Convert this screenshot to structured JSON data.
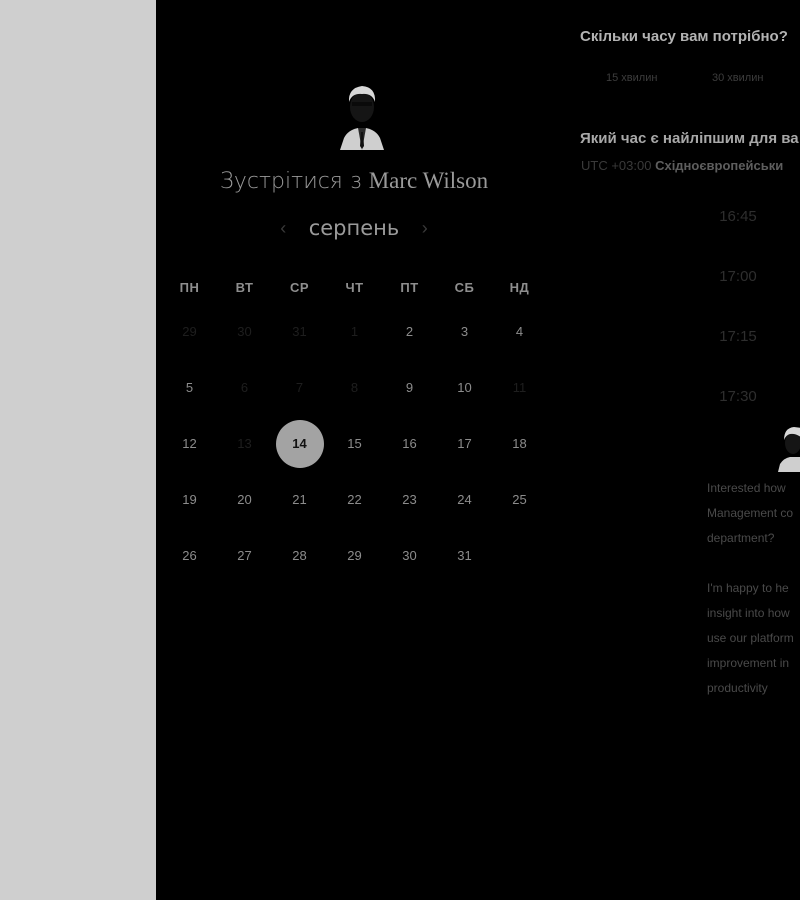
{
  "host": {
    "title_prefix": "Зустрітися з",
    "name": "Marc Wilson"
  },
  "calendar": {
    "month": "серпень",
    "prev_icon": "chevron-left-icon",
    "next_icon": "chevron-right-icon",
    "weekdays": [
      "ПН",
      "ВТ",
      "СР",
      "ЧТ",
      "ПТ",
      "СБ",
      "НД"
    ],
    "weeks": [
      [
        {
          "d": "29",
          "disabled": true
        },
        {
          "d": "30",
          "disabled": true
        },
        {
          "d": "31",
          "disabled": true
        },
        {
          "d": "1",
          "disabled": true
        },
        {
          "d": "2"
        },
        {
          "d": "3"
        },
        {
          "d": "4"
        }
      ],
      [
        {
          "d": "5"
        },
        {
          "d": "6",
          "disabled": true
        },
        {
          "d": "7",
          "disabled": true
        },
        {
          "d": "8",
          "disabled": true
        },
        {
          "d": "9"
        },
        {
          "d": "10"
        },
        {
          "d": "11",
          "disabled": true
        }
      ],
      [
        {
          "d": "12"
        },
        {
          "d": "13",
          "disabled": true
        },
        {
          "d": "14",
          "selected": true
        },
        {
          "d": "15"
        },
        {
          "d": "16"
        },
        {
          "d": "17"
        },
        {
          "d": "18"
        }
      ],
      [
        {
          "d": "19"
        },
        {
          "d": "20"
        },
        {
          "d": "21"
        },
        {
          "d": "22"
        },
        {
          "d": "23"
        },
        {
          "d": "24"
        },
        {
          "d": "25"
        }
      ],
      [
        {
          "d": "26"
        },
        {
          "d": "27"
        },
        {
          "d": "28"
        },
        {
          "d": "29"
        },
        {
          "d": "30"
        },
        {
          "d": "31"
        },
        {
          "d": "",
          "disabled": true
        }
      ]
    ]
  },
  "duration": {
    "question": "Скільки часу вам потрібно?",
    "options": [
      "15 хвилин",
      "30 хвилин"
    ]
  },
  "time": {
    "question": "Який час є найліпшим для ва",
    "tz_offset": "UTC +03:00",
    "tz_name": "Східноєвропейськи",
    "slots": [
      "16:45",
      "17:00",
      "17:15",
      "17:30"
    ]
  },
  "message": {
    "paragraphs": [
      "Interested how\nManagement co\ndepartment?",
      "I'm happy to he\ninsight into how\nuse our platform\nimprovement in\nproductivity"
    ]
  },
  "colors": {
    "panel_bg": "#000000",
    "gutter_bg": "#cfcfcf",
    "selected_day_bg": "#a3a3a3"
  }
}
